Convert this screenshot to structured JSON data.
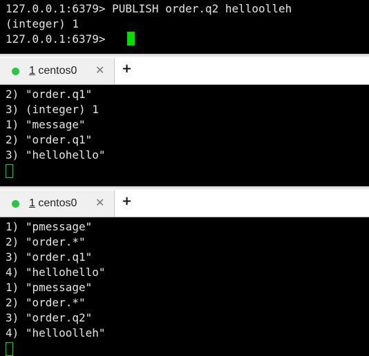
{
  "top_pane": {
    "lines": [
      "127.0.0.1:6379> PUBLISH order.q2 helloolleh",
      "(integer) 1",
      "127.0.0.1:6379> "
    ]
  },
  "middle_tabbar": {
    "tab": {
      "number": "1",
      "title": " centos0"
    },
    "close_glyph": "✕",
    "plus_glyph": "+"
  },
  "middle_pane": {
    "lines": [
      "2) \"order.q1\"",
      "3) (integer) 1",
      "1) \"message\"",
      "2) \"order.q1\"",
      "3) \"hellohello\""
    ]
  },
  "bottom_tabbar": {
    "tab": {
      "number": "1",
      "title": " centos0"
    },
    "close_glyph": "✕",
    "plus_glyph": "+"
  },
  "bottom_pane": {
    "lines": [
      "1) \"pmessage\"",
      "2) \"order.*\"",
      "3) \"order.q1\"",
      "4) \"hellohello\"",
      "1) \"pmessage\"",
      "2) \"order.*\"",
      "3) \"order.q2\"",
      "4) \"helloolleh\""
    ]
  },
  "colors": {
    "terminal_bg": "#000000",
    "terminal_fg": "#e6e6e6",
    "cursor": "#00e000",
    "tab_dot": "#27c93f"
  }
}
